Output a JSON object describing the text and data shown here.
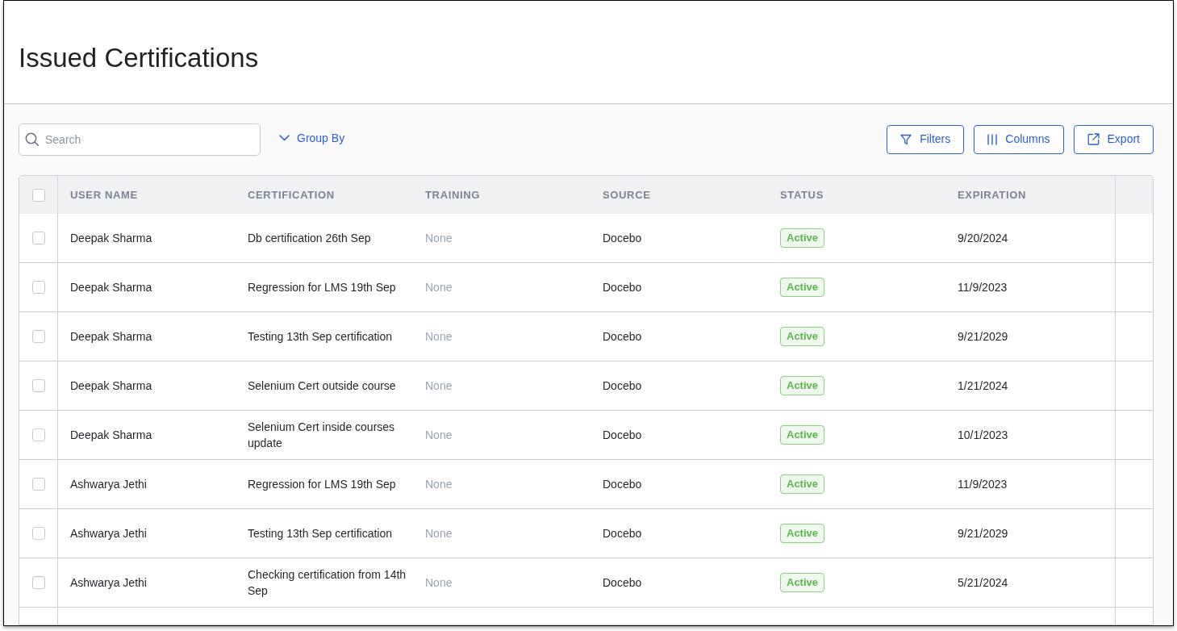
{
  "window": {
    "title": "Issued Certifications"
  },
  "toolbar": {
    "search": {
      "placeholder": "Search"
    },
    "group_by": {
      "label": "Group By"
    },
    "buttons": [
      {
        "label": "Filters",
        "kind": "filter"
      },
      {
        "label": "Columns",
        "kind": "columns"
      },
      {
        "label": "Export",
        "kind": "export"
      }
    ]
  },
  "table": {
    "select_all": {
      "checked": false
    },
    "columns": [
      "USER NAME",
      "CERTIFICATION",
      "TRAINING",
      "SOURCE",
      "STATUS",
      "EXPIRATION"
    ],
    "rows": [
      {
        "checked": false,
        "user_name": "Deepak Sharma",
        "certification": "Db certification 26th Sep",
        "training": {
          "text": "None",
          "muted": true
        },
        "source": "Docebo",
        "status": {
          "text": "Active",
          "kind": "active"
        },
        "expiration": "9/20/2024"
      },
      {
        "checked": false,
        "user_name": "Deepak Sharma",
        "certification": "Regression for LMS 19th Sep",
        "training": {
          "text": "None",
          "muted": true
        },
        "source": "Docebo",
        "status": {
          "text": "Active",
          "kind": "active"
        },
        "expiration": "11/9/2023"
      },
      {
        "checked": false,
        "user_name": "Deepak Sharma",
        "certification": "Testing 13th Sep certification",
        "training": {
          "text": "None",
          "muted": true
        },
        "source": "Docebo",
        "status": {
          "text": "Active",
          "kind": "active"
        },
        "expiration": "9/21/2029"
      },
      {
        "checked": false,
        "user_name": "Deepak Sharma",
        "certification": "Selenium Cert outside course",
        "training": {
          "text": "None",
          "muted": true
        },
        "source": "Docebo",
        "status": {
          "text": "Active",
          "kind": "active"
        },
        "expiration": "1/21/2024"
      },
      {
        "checked": false,
        "user_name": "Deepak Sharma",
        "certification": "Selenium Cert inside courses update",
        "training": {
          "text": "None",
          "muted": true
        },
        "source": "Docebo",
        "status": {
          "text": "Active",
          "kind": "active"
        },
        "expiration": "10/1/2023"
      },
      {
        "checked": false,
        "user_name": "Ashwarya Jethi",
        "certification": "Regression for LMS 19th Sep",
        "training": {
          "text": "None",
          "muted": true
        },
        "source": "Docebo",
        "status": {
          "text": "Active",
          "kind": "active"
        },
        "expiration": "11/9/2023"
      },
      {
        "checked": false,
        "user_name": "Ashwarya Jethi",
        "certification": "Testing 13th Sep certification",
        "training": {
          "text": "None",
          "muted": true
        },
        "source": "Docebo",
        "status": {
          "text": "Active",
          "kind": "active"
        },
        "expiration": "9/21/2029"
      },
      {
        "checked": false,
        "user_name": "Ashwarya Jethi",
        "certification": "Checking certification from 14th Sep",
        "training": {
          "text": "None",
          "muted": true
        },
        "source": "Docebo",
        "status": {
          "text": "Active",
          "kind": "active"
        },
        "expiration": "5/21/2024"
      }
    ]
  }
}
